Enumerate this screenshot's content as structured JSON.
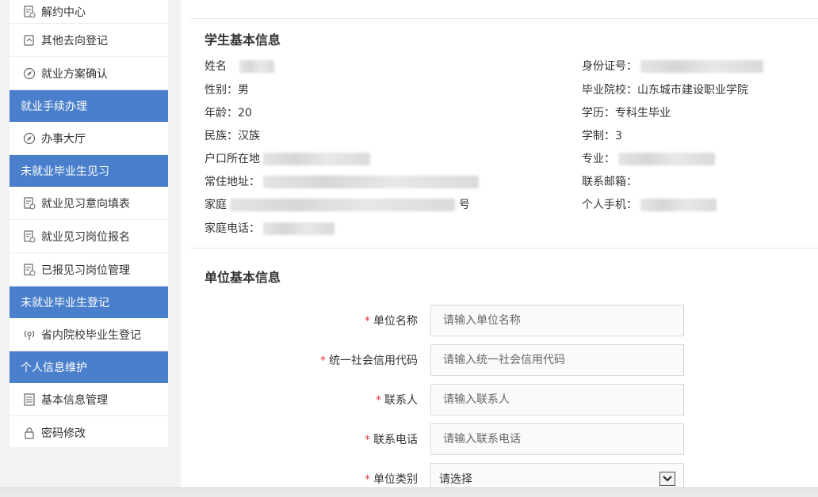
{
  "sidebar": {
    "items": [
      {
        "type": "item",
        "label": "解约中心",
        "icon": "document-icon"
      },
      {
        "type": "item",
        "label": "其他去向登记",
        "icon": "redirect-icon"
      },
      {
        "type": "item",
        "label": "就业方案确认",
        "icon": "compass-icon"
      },
      {
        "type": "header",
        "label": "就业手续办理"
      },
      {
        "type": "item",
        "label": "办事大厅",
        "icon": "compass-icon"
      },
      {
        "type": "header",
        "label": "未就业毕业生见习"
      },
      {
        "type": "item",
        "label": "就业见习意向填表",
        "icon": "document-icon"
      },
      {
        "type": "item",
        "label": "就业见习岗位报名",
        "icon": "document-icon"
      },
      {
        "type": "item",
        "label": "已报见习岗位管理",
        "icon": "document-icon"
      },
      {
        "type": "header",
        "label": "未就业毕业生登记"
      },
      {
        "type": "item",
        "label": "省内院校毕业生登记",
        "icon": "signal-icon"
      },
      {
        "type": "header",
        "label": "个人信息维护"
      },
      {
        "type": "item",
        "label": "基本信息管理",
        "icon": "list-icon"
      },
      {
        "type": "item",
        "label": "密码修改",
        "icon": "lock-icon"
      }
    ]
  },
  "student": {
    "title": "学生基本信息",
    "name_label": "姓名",
    "gender": "性别：男",
    "age": "年龄：20",
    "ethnicity": "民族：汉族",
    "hukou_label": "户口所在地",
    "address_label": "常住地址：",
    "home_label": "家庭",
    "home_suffix": "号",
    "home_phone_label": "家庭电话：",
    "id_label": "身份证号：",
    "school": "毕业院校：山东城市建设职业学院",
    "education": "学历：专科生毕业",
    "duration": "学制：3",
    "major_label": "专业：",
    "email_label": "联系邮箱：",
    "mobile_label": "个人手机："
  },
  "company": {
    "title": "单位基本信息",
    "required_mark": "*",
    "fields": [
      {
        "label": "单位名称",
        "placeholder": "请输入单位名称"
      },
      {
        "label": "统一社会信用代码",
        "placeholder": "请输入统一社会信用代码"
      },
      {
        "label": "联系人",
        "placeholder": "请输入联系人"
      },
      {
        "label": "联系电话",
        "placeholder": "请输入联系电话"
      }
    ],
    "category": {
      "label": "单位类别",
      "selected": "请选择"
    }
  }
}
